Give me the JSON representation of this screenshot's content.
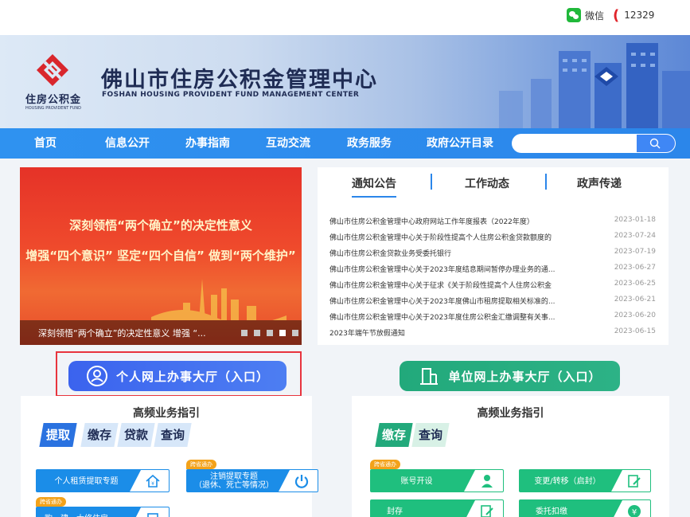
{
  "topbar": {
    "wechat_label": "微信",
    "phone": "12329"
  },
  "header": {
    "logo_cn": "住房公积金",
    "logo_en": "HOUSING PROVIDENT FUND",
    "title": "佛山市住房公积金管理中心",
    "subtitle": "FOSHAN HOUSING PROVIDENT FUND  MANAGEMENT CENTER"
  },
  "nav": {
    "items": [
      {
        "label": "首页"
      },
      {
        "label": "信息公开"
      },
      {
        "label": "办事指南"
      },
      {
        "label": "互动交流"
      },
      {
        "label": "政务服务"
      },
      {
        "label": "政府公开目录"
      }
    ],
    "search_placeholder": ""
  },
  "carousel": {
    "line1": "深刻领悟“两个确立”的决定性意义",
    "line2": "增强“四个意识” 坚定“四个自信” 做到“两个维护”",
    "caption": "深刻领悟“两个确立”的决定性意义 增强 “...",
    "slide_count": 5,
    "active_index": 3
  },
  "news": {
    "tabs": [
      "通知公告",
      "工作动态",
      "政声传递"
    ],
    "active_tab": 0,
    "items": [
      {
        "title": "佛山市住房公积金管理中心政府网站工作年度报表（2022年度）",
        "date": "2023-01-18"
      },
      {
        "title": "佛山市住房公积金管理中心关于阶段性提高个人住房公积金贷款额度的",
        "date": "2023-07-24"
      },
      {
        "title": "佛山市住房公积金贷款业务受委托银行",
        "date": "2023-07-19"
      },
      {
        "title": "佛山市住房公积金管理中心关于2023年度结息期间暂停办理业务的通...",
        "date": "2023-06-27"
      },
      {
        "title": "佛山市住房公积金管理中心关于征求《关于阶段性提高个人住房公积金",
        "date": "2023-06-25"
      },
      {
        "title": "佛山市住房公积金管理中心关于2023年度佛山市租房提取相关标准的...",
        "date": "2023-06-21"
      },
      {
        "title": "佛山市住房公积金管理中心关于2023年度住房公积金汇缴调整有关事...",
        "date": "2023-06-20"
      },
      {
        "title": "2023年端午节放假通知",
        "date": "2023-06-15"
      }
    ]
  },
  "entries": {
    "personal": "个人网上办事大厅（入口）",
    "unit": "单位网上办事大厅（入口）"
  },
  "guides": {
    "left": {
      "title": "高频业务指引",
      "tabs": [
        "提取",
        "缴存",
        "贷款",
        "查询"
      ],
      "services": [
        {
          "label": "个人租赁提取专题"
        },
        {
          "label_line1": "注销提取专题",
          "label_line2": "（退休、死亡等情况）",
          "tag": "跨省通办"
        },
        {
          "label": "购、建、大修住房",
          "tag": "跨省通办"
        }
      ]
    },
    "right": {
      "title": "高频业务指引",
      "tabs": [
        "缴存",
        "查询"
      ],
      "services": [
        {
          "label": "账号开设",
          "tag": "跨省通办"
        },
        {
          "label": "变更/转移（启封）"
        },
        {
          "label": "封存"
        },
        {
          "label": "委托扣缴"
        }
      ]
    }
  },
  "colors": {
    "nav_blue": "#2f92f0",
    "personal_btn": "#3b63ee",
    "unit_btn": "#22a97b",
    "highlight_frame": "#e8343e",
    "tag_orange": "#f3a21a"
  }
}
